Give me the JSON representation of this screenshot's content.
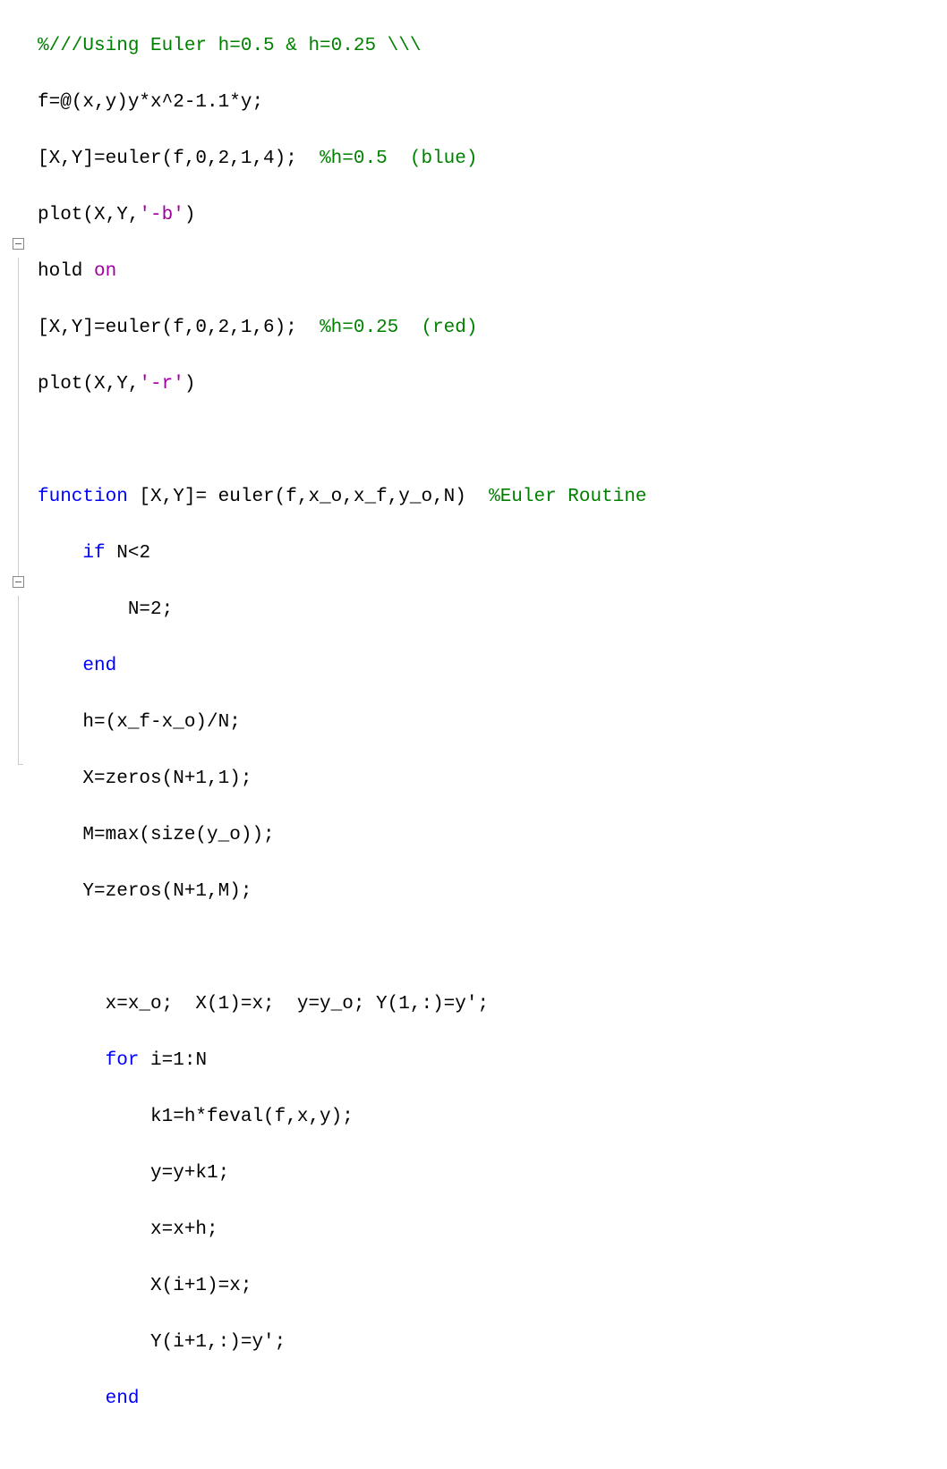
{
  "code": {
    "line1_comment": "%///Using Euler h=0.5 & h=0.25 \\\\\\",
    "line2": "f=@(x,y)y*x^2-1.1*y;",
    "line3a": "[X,Y]=euler(f,0,2,1,4);  ",
    "line3_comment": "%h=0.5  (blue)",
    "line4a": "plot(X,Y,",
    "line4_str": "'-b'",
    "line4b": ")",
    "line5a": "hold ",
    "line5_str": "on",
    "line6a": "[X,Y]=euler(f,0,2,1,6);  ",
    "line6_comment": "%h=0.25  (red)",
    "line7a": "plot(X,Y,",
    "line7_str": "'-r'",
    "line7b": ")",
    "line9_kw": "function",
    "line9a": " [X,Y]= euler(f,x_o,x_f,y_o,N)  ",
    "line9_comment": "%Euler Routine",
    "line10_indent": "    ",
    "line10_kw": "if",
    "line10a": " N<2",
    "line11": "        N=2;",
    "line12_indent": "    ",
    "line12_kw": "end",
    "line13": "    h=(x_f-x_o)/N;",
    "line14": "    X=zeros(N+1,1);",
    "line15": "    M=max(size(y_o));",
    "line16": "    Y=zeros(N+1,M);",
    "line18": "      x=x_o;  X(1)=x;  y=y_o; Y(1,:)=y';",
    "line19_indent": "      ",
    "line19_kw": "for",
    "line19a": " i=1:N",
    "line20": "          k1=h*feval(f,x,y);",
    "line21": "          y=y+k1;",
    "line22": "          x=x+h;",
    "line23": "          X(i+1)=x;",
    "line24": "          Y(i+1,:)=y';",
    "line25_indent": "      ",
    "line25_kw": "end"
  }
}
